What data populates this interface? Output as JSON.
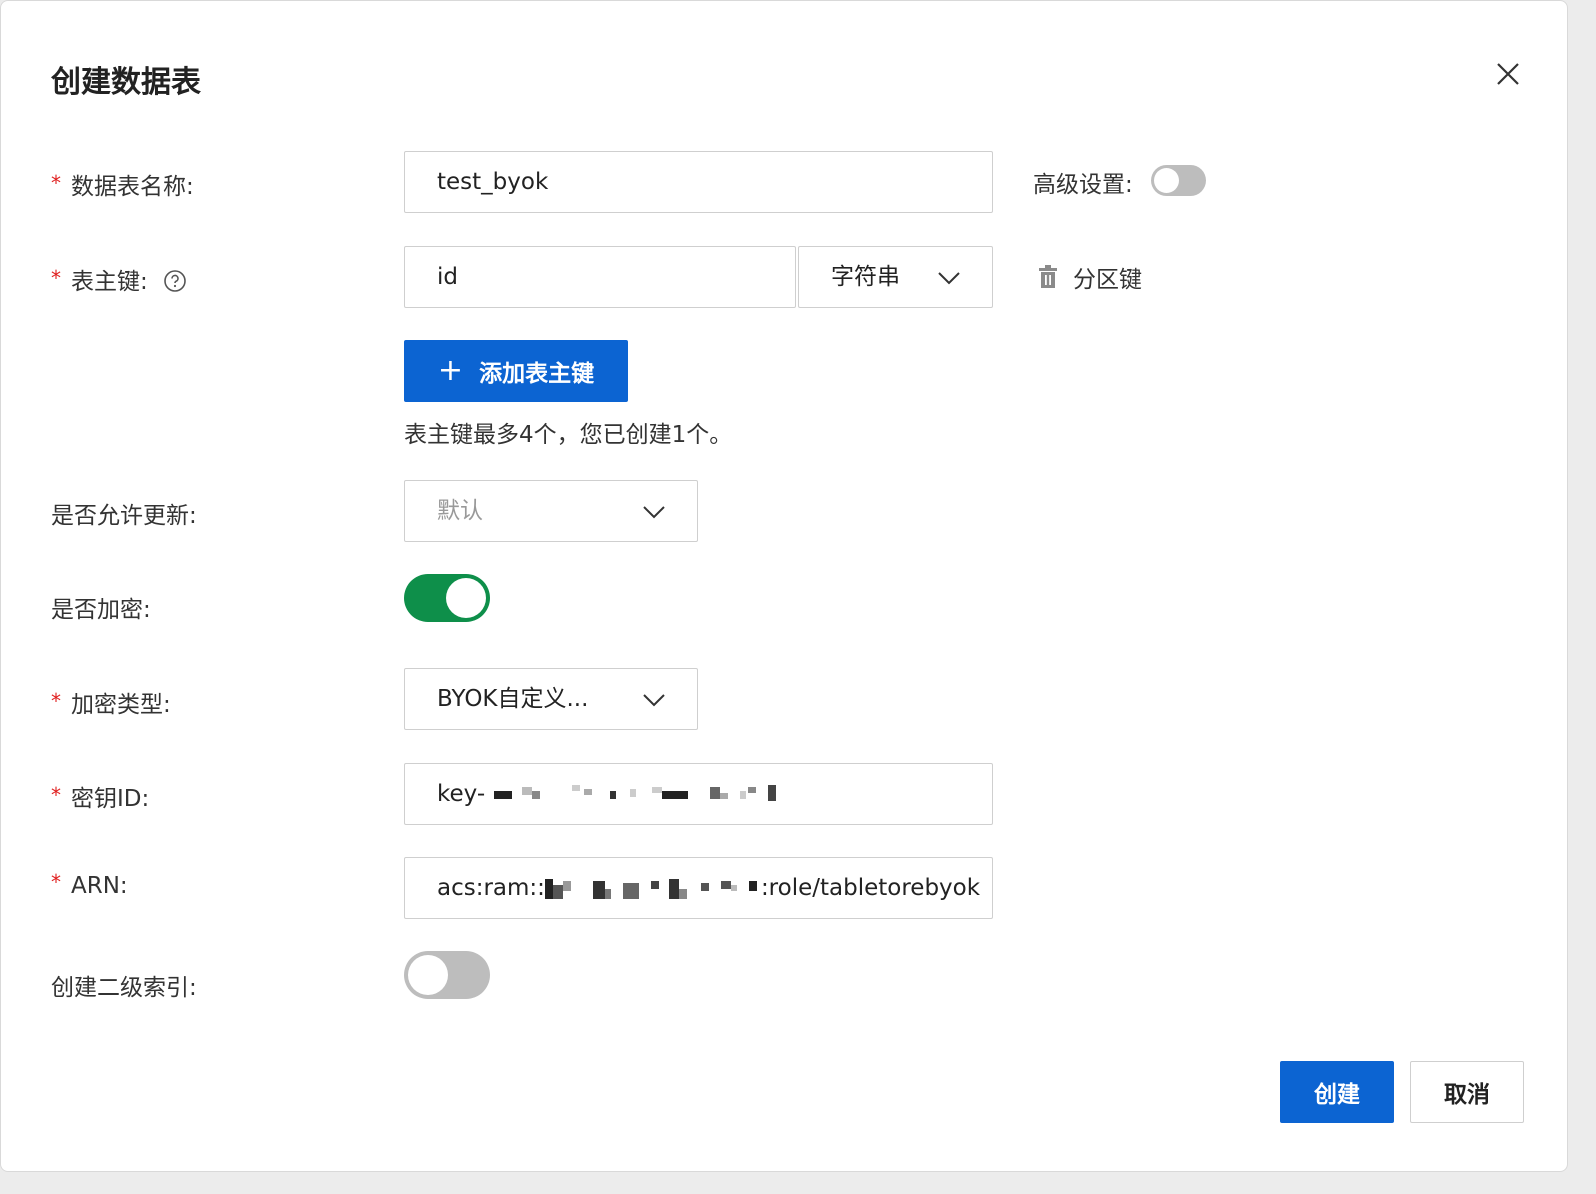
{
  "dialog": {
    "title": "创建数据表",
    "close_icon": "close-icon"
  },
  "table_name": {
    "required": "*",
    "label": "数据表名称:",
    "value": "test_byok"
  },
  "advanced": {
    "label": "高级设置:",
    "enabled": false
  },
  "primary_key": {
    "required": "*",
    "label": "表主键:",
    "help_icon": "question-circle-icon",
    "name_value": "id",
    "type_value": "字符串",
    "partition_label": "分区键",
    "partition_icon": "trash-icon",
    "add_button": "添加表主键",
    "add_icon": "plus-icon",
    "hint": "表主键最多4个，您已创建1个。"
  },
  "allow_update": {
    "label": "是否允许更新:",
    "value": "默认"
  },
  "encrypt": {
    "label": "是否加密:",
    "enabled": true
  },
  "encrypt_type": {
    "required": "*",
    "label": "加密类型:",
    "value": "BYOK自定义..."
  },
  "key_id": {
    "required": "*",
    "label": "密钥ID:",
    "prefix": "key-"
  },
  "arn": {
    "required": "*",
    "label": "ARN:",
    "prefix": "acs:ram::",
    "suffix": ":role/tabletorebyok"
  },
  "secondary_index": {
    "label": "创建二级索引:",
    "enabled": false
  },
  "footer": {
    "create": "创建",
    "cancel": "取消"
  },
  "colors": {
    "primary": "#0c64d2",
    "toggle_on": "#0e8f4a",
    "toggle_off": "#bdbdbd",
    "required": "#e02020"
  }
}
